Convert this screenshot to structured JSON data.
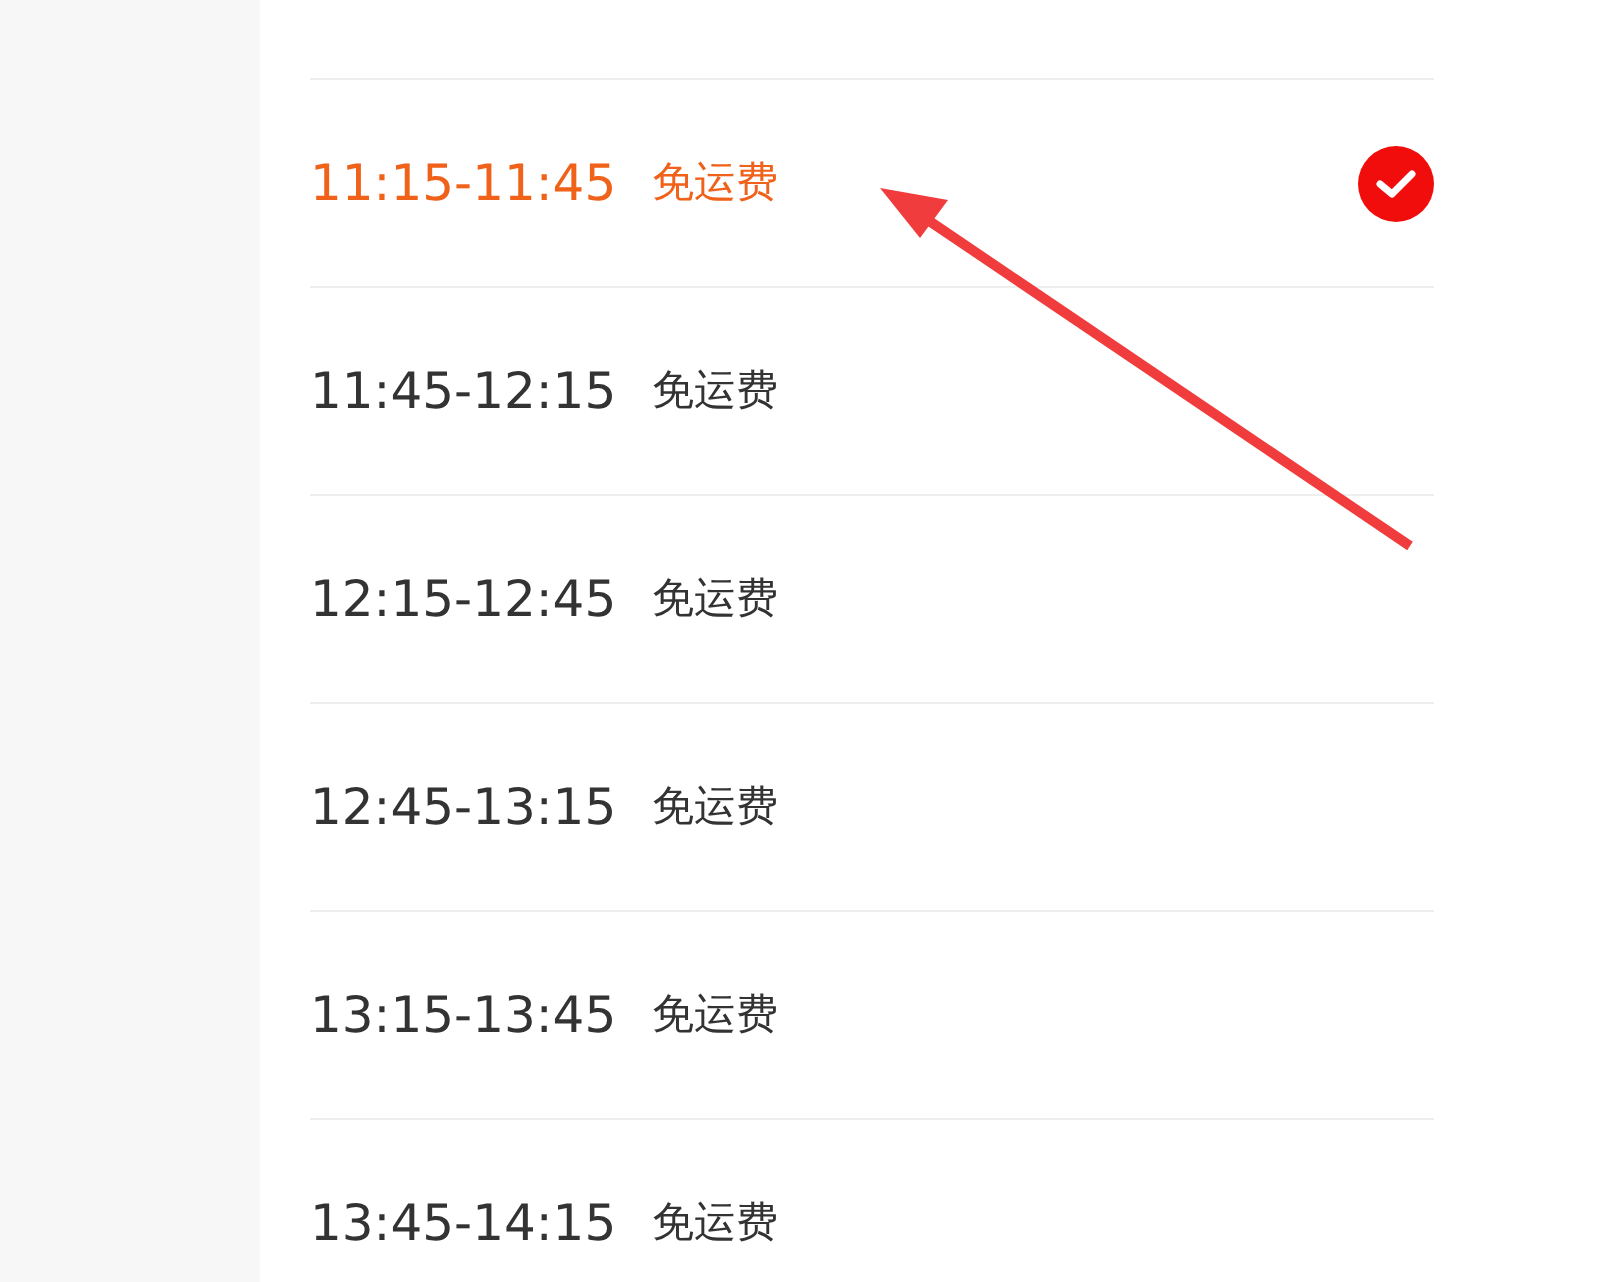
{
  "slots": [
    {
      "time": "11:15-11:45",
      "fee": "免运费",
      "selected": true
    },
    {
      "time": "11:45-12:15",
      "fee": "免运费",
      "selected": false
    },
    {
      "time": "12:15-12:45",
      "fee": "免运费",
      "selected": false
    },
    {
      "time": "12:45-13:15",
      "fee": "免运费",
      "selected": false
    },
    {
      "time": "13:15-13:45",
      "fee": "免运费",
      "selected": false
    },
    {
      "time": "13:45-14:15",
      "fee": "免运费",
      "selected": false
    }
  ]
}
